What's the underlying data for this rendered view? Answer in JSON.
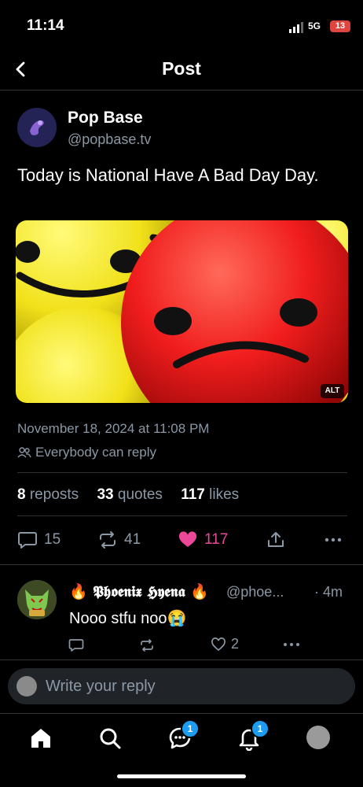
{
  "status_bar": {
    "time": "11:14",
    "network": "5G",
    "battery": "13"
  },
  "header": {
    "title": "Post"
  },
  "post": {
    "author_name": "Pop Base",
    "author_handle": "@popbase.tv",
    "text": "Today is National Have A Bad Day Day.",
    "alt_label": "ALT",
    "timestamp": "November 18, 2024 at 11:08 PM",
    "reply_setting": "Everybody can reply",
    "stats": {
      "reposts_count": "8",
      "reposts_label": "reposts",
      "quotes_count": "33",
      "quotes_label": "quotes",
      "likes_count": "117",
      "likes_label": "likes"
    },
    "actions": {
      "replies": "15",
      "reposts": "41",
      "likes": "117"
    },
    "colors": {
      "like_active": "#ec4899"
    }
  },
  "reply": {
    "name": "🔥 𝕻𝖍𝖔𝖊𝖓𝖎𝖝 𝕳𝖞𝖊𝖓𝖆 🔥",
    "handle": "@phoe...",
    "time": "· 4m",
    "text": "Nooo stfu noo😭",
    "likes": "2"
  },
  "composer": {
    "placeholder": "Write your reply"
  },
  "tabbar": {
    "messages_badge": "1",
    "notifications_badge": "1"
  }
}
